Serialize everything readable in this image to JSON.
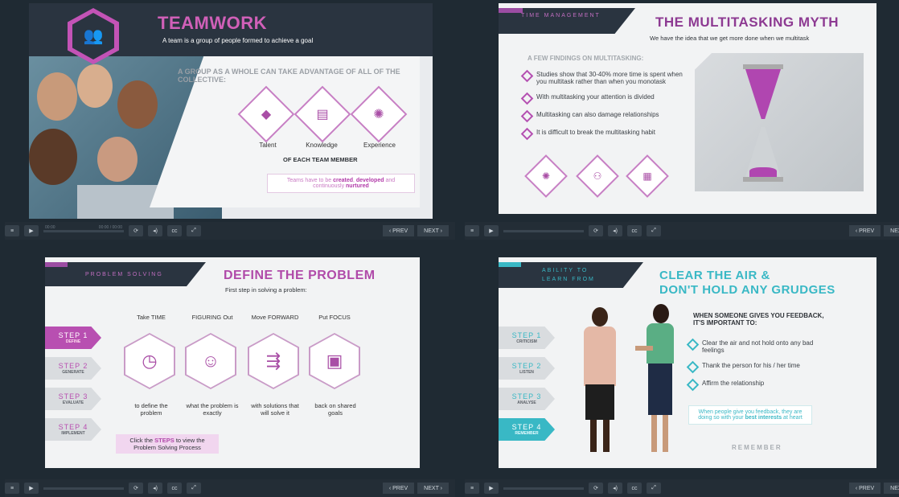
{
  "colors": {
    "bg": "#1f2a33",
    "pink": "#c353b6",
    "purple": "#8d3a92",
    "teal": "#39b8c5",
    "gray": "#5c6168"
  },
  "player": {
    "prev": "‹ PREV",
    "next": "NEXT ›",
    "time_left": "00:00",
    "time_right": "00:00 / 00:00"
  },
  "slide1": {
    "title": "TEAMWORK",
    "subtitle": "A team is a group of people formed to achieve a goal",
    "heading": "A GROUP AS A WHOLE CAN TAKE ADVANTAGE OF ALL OF THE COLLECTIVE:",
    "items": [
      "Talent",
      "Knowledge",
      "Experience"
    ],
    "subheading": "OF EACH TEAM MEMBER",
    "footer_1": "Teams have to be ",
    "footer_created": "created",
    "footer_sep": ", ",
    "footer_developed": "developed",
    "footer_2": " and continuously ",
    "footer_nurtured": "nurtured"
  },
  "slide2": {
    "kicker": "TIME MANAGEMENT",
    "title": "THE MULTITASKING MYTH",
    "subtitle": "We have the idea that we get more done when we multitask",
    "heading": "A FEW FINDINGS ON MULTITASKING:",
    "bullets": [
      "Studies show that 30-40% more time is spent when you multitask rather than when you monotask",
      "With multitasking your attention is divided",
      "Multitasking can also damage relationships",
      "It is difficult to break the multitasking habit"
    ]
  },
  "slide3": {
    "kicker": "PROBLEM SOLVING",
    "title": "DEFINE THE PROBLEM",
    "subtitle": "First step in solving a problem:",
    "steps": [
      {
        "n": "STEP 1",
        "l": "DEFINE"
      },
      {
        "n": "STEP 2",
        "l": "GENERATE"
      },
      {
        "n": "STEP 3",
        "l": "EVALUATE"
      },
      {
        "n": "STEP 4",
        "l": "IMPLEMENT"
      }
    ],
    "col_heads": [
      "Take TIME",
      "FIGURING Out",
      "Move FORWARD",
      "Put FOCUS"
    ],
    "col_texts": [
      "to define the problem",
      "what the problem is exactly",
      "with solutions that will solve it",
      "back on shared goals"
    ],
    "cta_1": "Click the ",
    "cta_steps": "STEPS",
    "cta_2": " to view the Problem Solving Process"
  },
  "slide4": {
    "kicker": "ABILITY TO LEARN FROM",
    "title_1": "CLEAR THE AIR &",
    "title_2": "DON'T HOLD ANY GRUDGES",
    "steps": [
      {
        "n": "STEP 1",
        "l": "CRITICISM"
      },
      {
        "n": "STEP 2",
        "l": "LISTEN"
      },
      {
        "n": "STEP 3",
        "l": "ANALYSE"
      },
      {
        "n": "STEP 4",
        "l": "REMEMBER"
      }
    ],
    "heading": "WHEN SOMEONE GIVES YOU FEEDBACK, IT'S IMPORTANT TO:",
    "bullets": [
      "Clear the air and not hold onto any bad feelings",
      "Thank the person for his / her time",
      "Affirm the relationship"
    ],
    "note_1": "When people give you feedback, they are doing so with your ",
    "note_best": "best interests",
    "note_2": " at heart",
    "remember": "REMEMBER"
  }
}
